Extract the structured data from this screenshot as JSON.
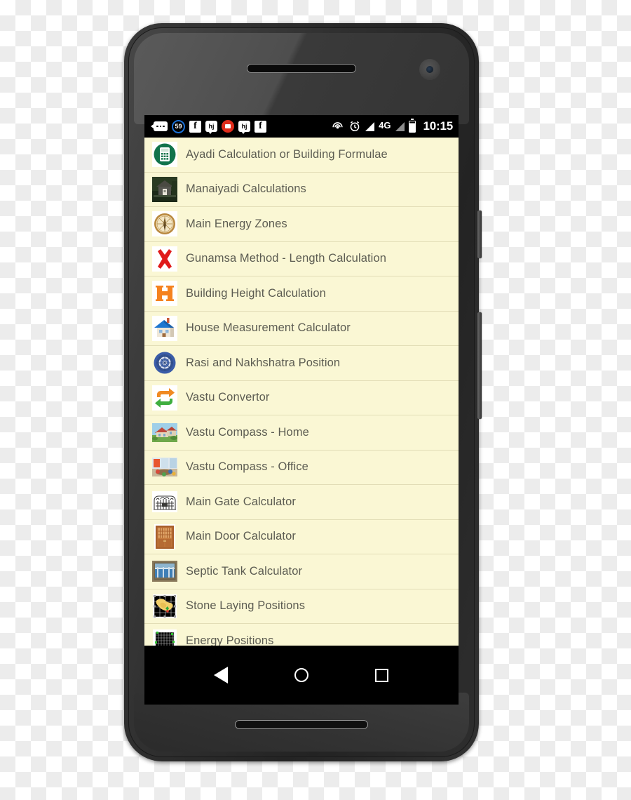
{
  "device": {
    "name": "android-phone-mockup",
    "earpiece": "earpiece-speaker",
    "front_camera": "front-camera",
    "bottom_speaker": "bottom-speaker",
    "power_button": "power-button",
    "volume_button": "volume-rocker"
  },
  "status_bar": {
    "clock": "10:15",
    "notification_count": "59",
    "network_label": "4G",
    "icons": [
      "messages-icon",
      "notification-count-badge",
      "facebook-icon",
      "hike-icon",
      "youtube-icon",
      "hike-icon-2",
      "facebook-icon-2",
      "hotspot-icon",
      "alarm-icon",
      "signal-icon",
      "network-type-label",
      "signal-icon-2",
      "battery-icon",
      "clock-label"
    ]
  },
  "list": {
    "items": [
      {
        "label": "Ayadi Calculation or Building Formulae",
        "icon": "calculator-icon"
      },
      {
        "label": "Manaiyadi Calculations",
        "icon": "temple-photo-icon"
      },
      {
        "label": "Main Energy Zones",
        "icon": "compass-icon"
      },
      {
        "label": "Gunamsa Method - Length Calculation",
        "icon": "red-cross-icon"
      },
      {
        "label": "Building Height Calculation",
        "icon": "letter-h-icon"
      },
      {
        "label": "House Measurement Calculator",
        "icon": "house-icon"
      },
      {
        "label": "Rasi and Nakhshatra Position",
        "icon": "chakra-wheel-icon"
      },
      {
        "label": "Vastu Convertor",
        "icon": "convert-arrows-icon"
      },
      {
        "label": "Vastu Compass - Home",
        "icon": "home-photo-icon"
      },
      {
        "label": "Vastu Compass - Office",
        "icon": "office-photo-icon"
      },
      {
        "label": "Main Gate Calculator",
        "icon": "gate-icon"
      },
      {
        "label": "Main Door Calculator",
        "icon": "door-icon"
      },
      {
        "label": "Septic Tank Calculator",
        "icon": "water-tank-photo-icon"
      },
      {
        "label": "Stone Laying Positions",
        "icon": "site-map-icon"
      },
      {
        "label": "Energy Positions",
        "icon": "energy-grid-icon"
      }
    ]
  },
  "nav_bar": {
    "back": "back-button",
    "home": "home-button",
    "recents": "recents-button"
  },
  "colors": {
    "list_background": "#faf7d4",
    "list_divider": "#e2ddb6",
    "label_text": "#5c5c52",
    "system_bar": "#000000",
    "accent_green": "#1b7a52",
    "accent_orange": "#f5821f",
    "accent_red": "#e01b1b",
    "accent_blue": "#3a5ca8"
  }
}
